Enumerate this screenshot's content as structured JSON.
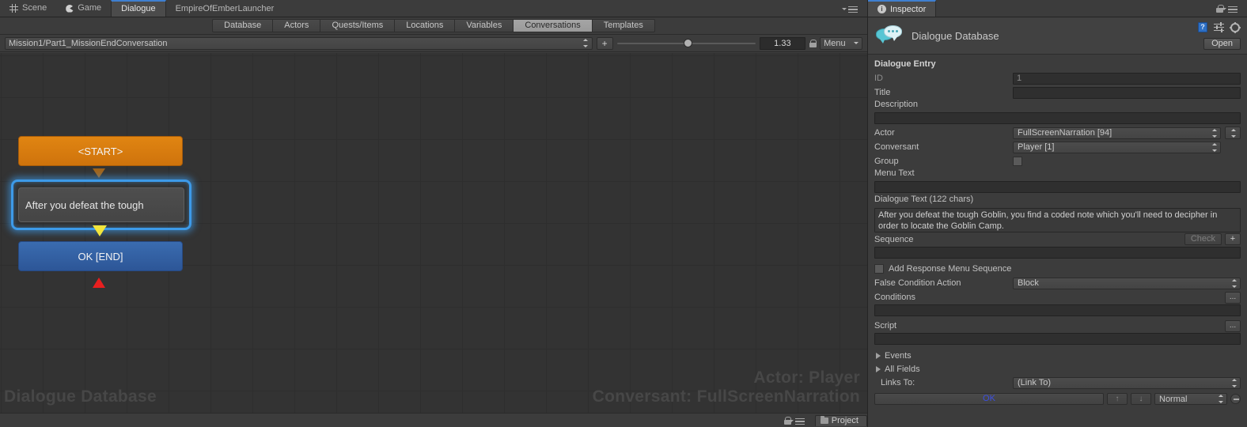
{
  "editor": {
    "tabs": [
      {
        "label": "Scene",
        "icon": "grid-icon",
        "active": false
      },
      {
        "label": "Game",
        "icon": "game-icon",
        "active": false
      },
      {
        "label": "Dialogue",
        "icon": "",
        "active": true
      }
    ],
    "window_title": "EmpireOfEmberLauncher",
    "options_icon": "hamburger-menu-icon"
  },
  "subtabs": [
    {
      "label": "Database",
      "active": false
    },
    {
      "label": "Actors",
      "active": false
    },
    {
      "label": "Quests/Items",
      "active": false
    },
    {
      "label": "Locations",
      "active": false
    },
    {
      "label": "Variables",
      "active": false
    },
    {
      "label": "Conversations",
      "active": true
    },
    {
      "label": "Templates",
      "active": false
    }
  ],
  "conversation_toolbar": {
    "conversation": "Mission1/Part1_MissionEndConversation",
    "add_label": "+",
    "zoom_value": "1.33",
    "lock_icon": "lock-icon",
    "menu_label": "Menu"
  },
  "canvas": {
    "nodes": [
      {
        "id": "start",
        "label": "<START>",
        "type": "start",
        "color": "#d9780f"
      },
      {
        "id": "entry1",
        "label": "After you defeat the tough",
        "type": "entry",
        "selected": true,
        "color": "#4a4a4a"
      },
      {
        "id": "ok-end",
        "label": "OK [END]",
        "type": "end",
        "color": "#2f5d9e"
      }
    ],
    "connectors": [
      {
        "from": "start",
        "to": "entry1",
        "color": "#a2641a"
      },
      {
        "from": "entry1",
        "to": "ok-end",
        "color": "#f2e53c"
      },
      {
        "from": "ok-end",
        "to": "up",
        "color": "#e81f1f"
      }
    ],
    "watermark_database": "Dialogue Database",
    "watermark_actor": "Actor: Player",
    "watermark_conversant": "Conversant: FullScreenNarration"
  },
  "statusbar": {
    "project_tab": "Project",
    "lock_icon": "lock-icon",
    "menu_icon": "hamburger-menu-icon"
  },
  "inspector": {
    "tab_label": "Inspector",
    "info_icon": "info-icon",
    "lock_icon": "lock-icon",
    "menu_icon": "hamburger-menu-icon",
    "header": {
      "title": "Dialogue Database",
      "icon": "dialogue-bubble-icon",
      "help_icon": "help-icon",
      "preset_icon": "preset-icon",
      "gear_icon": "gear-icon",
      "open_label": "Open"
    },
    "section_title": "Dialogue Entry",
    "fields": {
      "id_label": "ID",
      "id_value": "1",
      "title_label": "Title",
      "title_value": "",
      "description_label": "Description",
      "description_value": "",
      "actor_label": "Actor",
      "actor_value": "FullScreenNarration [94]",
      "conversant_label": "Conversant",
      "conversant_value": "Player [1]",
      "group_label": "Group",
      "group_checked": false,
      "menu_text_label": "Menu Text",
      "menu_text_value": "",
      "dialogue_text_label": "Dialogue Text (122 chars)",
      "dialogue_text_value": "After you defeat the tough Goblin, you find a coded note which you'll need to decipher in order to locate the Goblin Camp.",
      "sequence_label": "Sequence",
      "sequence_value": "",
      "check_label": "Check",
      "plus_label": "+",
      "add_response_menu_label": "Add Response Menu Sequence",
      "add_response_menu_checked": false,
      "false_condition_label": "False Condition Action",
      "false_condition_value": "Block",
      "conditions_label": "Conditions",
      "conditions_value": "",
      "conditions_more": "...",
      "script_label": "Script",
      "script_value": "",
      "script_more": "...",
      "events_label": "Events",
      "all_fields_label": "All Fields",
      "links_to_label": "Links To:",
      "links_to_value": "(Link To)",
      "link_entry_label": "OK",
      "link_up_label": "↑",
      "link_down_label": "↓",
      "link_priority_value": "Normal"
    }
  }
}
